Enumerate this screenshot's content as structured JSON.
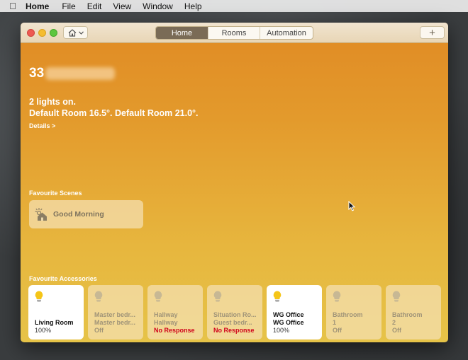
{
  "menubar": {
    "apple_icon": "apple-icon",
    "app_name": "Home",
    "items": [
      "File",
      "Edit",
      "View",
      "Window",
      "Help"
    ]
  },
  "toolbar": {
    "home_menu_icon": "house-icon",
    "tabs": [
      "Home",
      "Rooms",
      "Automation"
    ],
    "active_tab": "Home",
    "add_label": "+"
  },
  "home": {
    "name_prefix": "33",
    "status_line1": "2 lights on.",
    "status_line2": "Default Room 16.5°. Default Room 21.0°.",
    "details_label": "Details >"
  },
  "scenes": {
    "section_label": "Favourite Scenes",
    "items": [
      {
        "label": "Good Morning",
        "icon": "sunrise-house-icon"
      }
    ]
  },
  "accessories": {
    "section_label": "Favourite Accessories",
    "items": [
      {
        "line1": "Living Room",
        "line2": "",
        "state": "100%",
        "on": true
      },
      {
        "line1": "Master bedr...",
        "line2": "Master bedr...",
        "state": "Off",
        "on": false
      },
      {
        "line1": "Hallway",
        "line2": "Hallway",
        "state": "No Response",
        "on": false,
        "alert": true
      },
      {
        "line1": "Situation Ro...",
        "line2": "Guest bedr...",
        "state": "No Response",
        "on": false,
        "alert": true
      },
      {
        "line1": "WG Office",
        "line2": "WG Office",
        "state": "100%",
        "on": true
      },
      {
        "line1": "Bathroom",
        "line2": "1",
        "state": "Off",
        "on": false
      },
      {
        "line1": "Bathroom",
        "line2": "2",
        "state": "Off",
        "on": false
      }
    ]
  },
  "colors": {
    "accent_on_bulb": "#f5c518",
    "off_bulb": "#c7b894",
    "alert_text": "#d0021b"
  }
}
